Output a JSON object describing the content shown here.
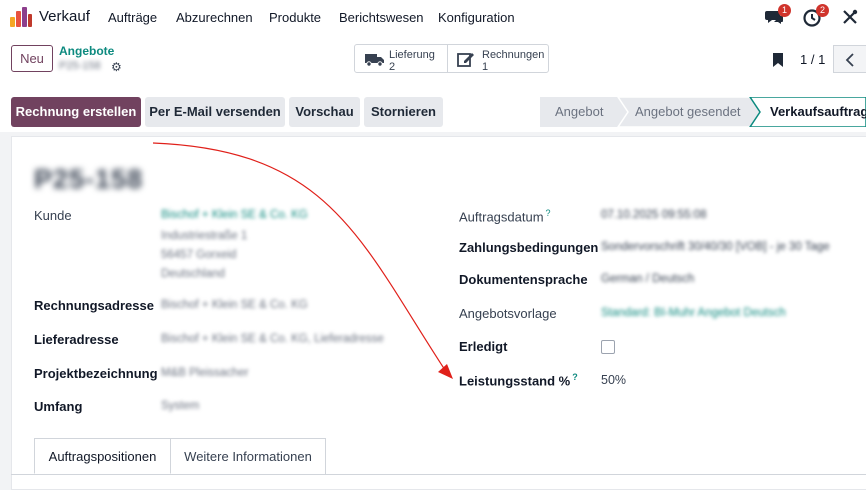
{
  "topnav": {
    "app_name": "Verkauf",
    "menu": [
      "Aufträge",
      "Abzurechnen",
      "Produkte",
      "Berichtswesen",
      "Konfiguration"
    ],
    "messages_count": "1",
    "activities_count": "2",
    "icons": [
      "app-logo-icon",
      "chat-icon",
      "clock-icon",
      "tools-icon"
    ]
  },
  "control": {
    "new_label": "Neu",
    "breadcrumb_parent": "Angebote",
    "record_ref": "P25-158",
    "smart_buttons": [
      {
        "label": "Lieferung",
        "count": "2"
      },
      {
        "label": "Rechnungen",
        "count": "1"
      }
    ],
    "pager": "1 / 1"
  },
  "actions": {
    "create_invoice": "Rechnung erstellen",
    "send_email": "Per E-Mail versenden",
    "preview": "Vorschau",
    "cancel": "Stornieren"
  },
  "status": {
    "stages": [
      "Angebot",
      "Angebot gesendet",
      "Verkaufsauftrag"
    ],
    "current": "Verkaufsauftrag"
  },
  "form": {
    "record_name": "P25-158",
    "left": {
      "customer_label": "Kunde",
      "customer_lines": [
        "Bischof + Klein SE & Co. KG",
        "Industriestraße 1",
        "56457 Gorxeid",
        "Deutschland"
      ],
      "invoice_address_label": "Rechnungsadresse",
      "invoice_address": "Bischof + Klein SE & Co. KG",
      "delivery_address_label": "Lieferadresse",
      "delivery_address": "Bischof + Klein SE & Co. KG, Lieferadresse",
      "project_label": "Projektbezeichnung",
      "project": "M&B Pleissacher",
      "scope_label": "Umfang",
      "scope": "System"
    },
    "right": {
      "order_date_label": "Auftragsdatum",
      "order_date": "07.10.2025 09:55:08",
      "payment_terms_label": "Zahlungsbedingungen",
      "payment_terms": "Sondervorschrift 30/40/30 [VOB] - je 30 Tage",
      "doc_language_label": "Dokumentensprache",
      "doc_language": "German / Deutsch",
      "template_label": "Angebotsvorlage",
      "template": "Standard: BI-Muhr Angebot Deutsch",
      "done_label": "Erledigt",
      "progress_label": "Leistungsstand %",
      "progress": "50%"
    },
    "help_mark": "?"
  },
  "tabs": [
    "Auftragspositionen",
    "Weitere Informationen"
  ],
  "colors": {
    "primary": "#71425f",
    "link": "#0d8a7f",
    "annotation_arrow": "#e0201a",
    "badge": "#d0342c"
  }
}
